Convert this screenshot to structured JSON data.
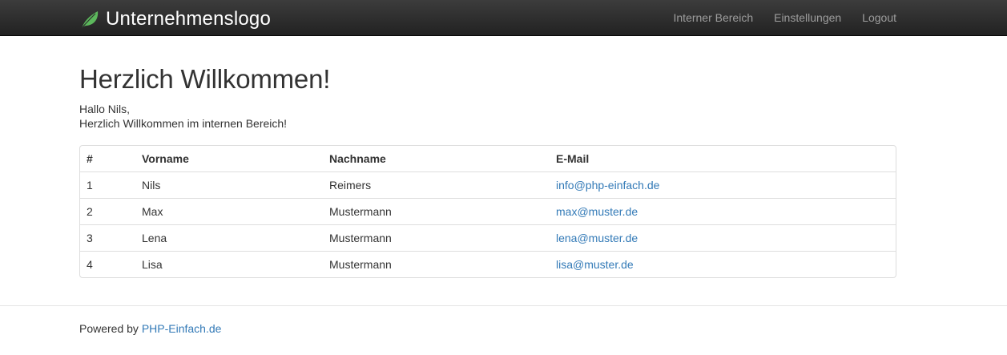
{
  "navbar": {
    "brand": "Unternehmenslogo",
    "brand_icon": "leaf-icon",
    "links": [
      {
        "label": "Interner Bereich"
      },
      {
        "label": "Einstellungen"
      },
      {
        "label": "Logout"
      }
    ]
  },
  "main": {
    "title": "Herzlich Willkommen!",
    "greeting": "Hallo Nils,",
    "message": "Herzlich Willkommen im internen Bereich!"
  },
  "table": {
    "headers": [
      "#",
      "Vorname",
      "Nachname",
      "E-Mail"
    ],
    "rows": [
      {
        "id": "1",
        "first": "Nils",
        "last": "Reimers",
        "email": "info@php-einfach.de"
      },
      {
        "id": "2",
        "first": "Max",
        "last": "Mustermann",
        "email": "max@muster.de"
      },
      {
        "id": "3",
        "first": "Lena",
        "last": "Mustermann",
        "email": "lena@muster.de"
      },
      {
        "id": "4",
        "first": "Lisa",
        "last": "Mustermann",
        "email": "lisa@muster.de"
      }
    ]
  },
  "footer": {
    "prefix": "Powered by ",
    "link": "PHP-Einfach.de"
  },
  "colors": {
    "navbar_bg": "#222222",
    "nav_link": "#9d9d9d",
    "link": "#337ab7",
    "leaf": "#5cb85c"
  }
}
